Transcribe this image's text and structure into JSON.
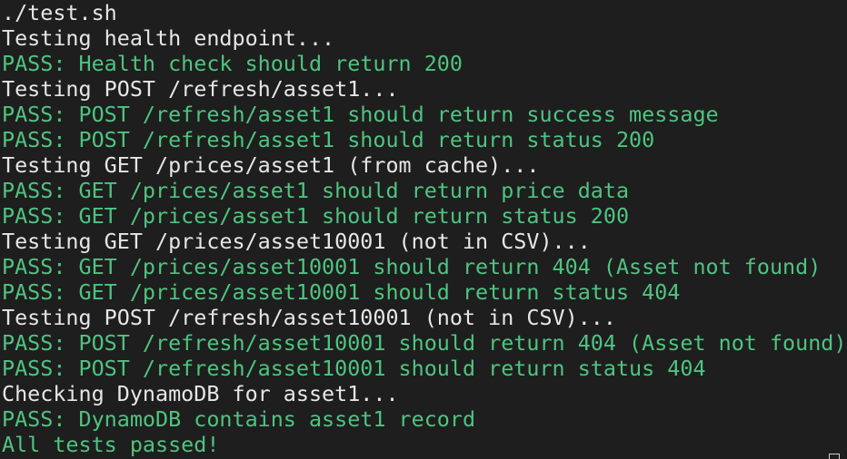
{
  "terminal": {
    "lines": [
      {
        "type": "info",
        "text": "./test.sh"
      },
      {
        "type": "info",
        "text": "Testing health endpoint..."
      },
      {
        "type": "pass",
        "text": "PASS: Health check should return 200"
      },
      {
        "type": "info",
        "text": "Testing POST /refresh/asset1..."
      },
      {
        "type": "pass",
        "text": "PASS: POST /refresh/asset1 should return success message"
      },
      {
        "type": "pass",
        "text": "PASS: POST /refresh/asset1 should return status 200"
      },
      {
        "type": "info",
        "text": "Testing GET /prices/asset1 (from cache)..."
      },
      {
        "type": "pass",
        "text": "PASS: GET /prices/asset1 should return price data"
      },
      {
        "type": "pass",
        "text": "PASS: GET /prices/asset1 should return status 200"
      },
      {
        "type": "info",
        "text": "Testing GET /prices/asset10001 (not in CSV)..."
      },
      {
        "type": "pass",
        "text": "PASS: GET /prices/asset10001 should return 404 (Asset not found)"
      },
      {
        "type": "pass",
        "text": "PASS: GET /prices/asset10001 should return status 404"
      },
      {
        "type": "info",
        "text": "Testing POST /refresh/asset10001 (not in CSV)..."
      },
      {
        "type": "pass",
        "text": "PASS: POST /refresh/asset10001 should return 404 (Asset not found)"
      },
      {
        "type": "pass",
        "text": "PASS: POST /refresh/asset10001 should return status 404"
      },
      {
        "type": "info",
        "text": "Checking DynamoDB for asset1..."
      },
      {
        "type": "pass",
        "text": "PASS: DynamoDB contains asset1 record"
      },
      {
        "type": "pass",
        "text": "All tests passed!"
      }
    ],
    "colors": {
      "background": "#1e1e1e",
      "info_text": "#e6e6e6",
      "pass_text": "#4ec480"
    }
  }
}
